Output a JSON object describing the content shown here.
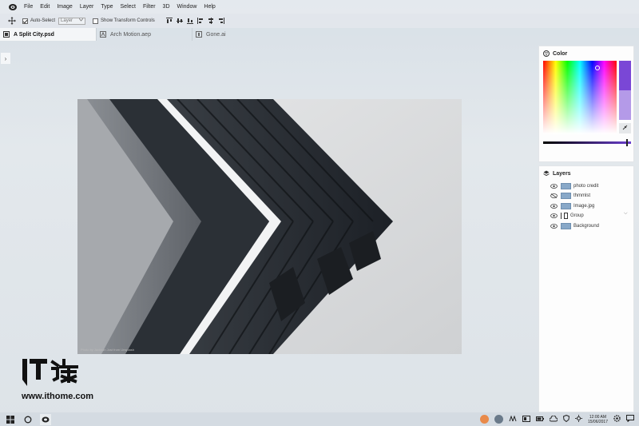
{
  "menu": [
    "File",
    "Edit",
    "Image",
    "Layer",
    "Type",
    "Select",
    "Filter",
    "3D",
    "Window",
    "Help"
  ],
  "options": {
    "auto_select_label": "Auto-Select",
    "auto_select_value": "Layer",
    "transform_label": "Show Transform Controls"
  },
  "tabs": [
    {
      "label": "A Split City.psd",
      "active": true
    },
    {
      "label": "Arch Motion.aep",
      "active": false
    },
    {
      "label": "Gone.ai",
      "active": false
    }
  ],
  "expand_glyph": "›",
  "canvas": {
    "credit": "Photo by Jackson Jost from Unsplash"
  },
  "color_panel": {
    "title": "Color",
    "primary_color": "#7a47d6",
    "secondary_color": "#b49ae8"
  },
  "layers_panel": {
    "title": "Layers",
    "layers": [
      {
        "name": "photo credit",
        "visible": true
      },
      {
        "name": "thmmlst",
        "visible": false
      },
      {
        "name": "Image.jpg",
        "visible": true
      },
      {
        "name": "Group",
        "visible": true,
        "is_group": true
      },
      {
        "name": "Background",
        "visible": true
      }
    ],
    "group_chevron": "⌵"
  },
  "watermark": {
    "text": "www.ithome.com"
  },
  "taskbar": {
    "time": "12:00 AM",
    "date": "15/06/2017"
  }
}
